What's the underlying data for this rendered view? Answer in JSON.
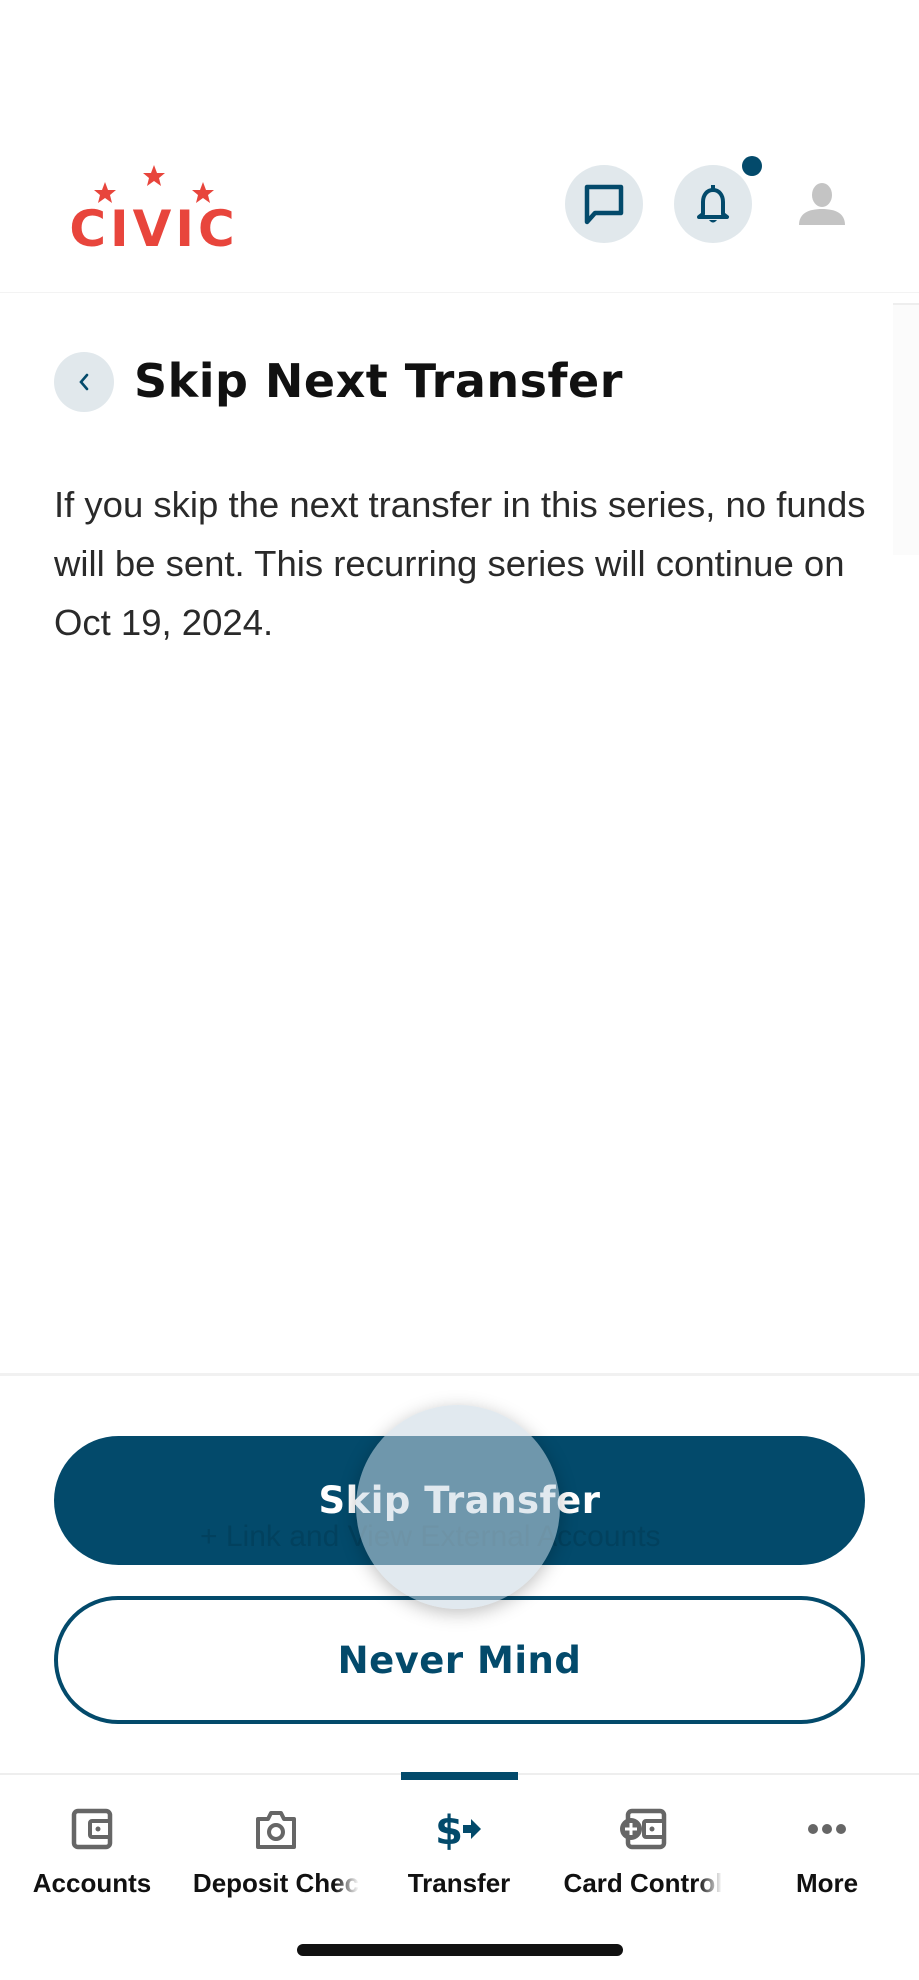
{
  "header": {
    "logo_text": "CIVIC",
    "brand_color": "#e8453c",
    "icons": [
      "chat-icon",
      "bell-icon",
      "profile-icon"
    ],
    "has_notification": true
  },
  "page": {
    "title": "Skip Next Transfer",
    "description": "If you skip the next transfer in this series, no funds will be sent. This recurring series will continue on Oct 19, 2024."
  },
  "actions": {
    "primary_label": "Skip Transfer",
    "secondary_label": "Never Mind",
    "background_ghost_text": "+ Link and View External Accounts",
    "accent_color": "#034a6b"
  },
  "nav": {
    "active_index": 2,
    "items": [
      {
        "label": "Accounts",
        "icon": "wallet-icon"
      },
      {
        "label": "Deposit Chec",
        "icon": "camera-icon"
      },
      {
        "label": "Transfer",
        "icon": "dollar-transfer-icon"
      },
      {
        "label": "Card Control",
        "icon": "card-control-icon"
      },
      {
        "label": "More",
        "icon": "more-icon"
      }
    ]
  }
}
